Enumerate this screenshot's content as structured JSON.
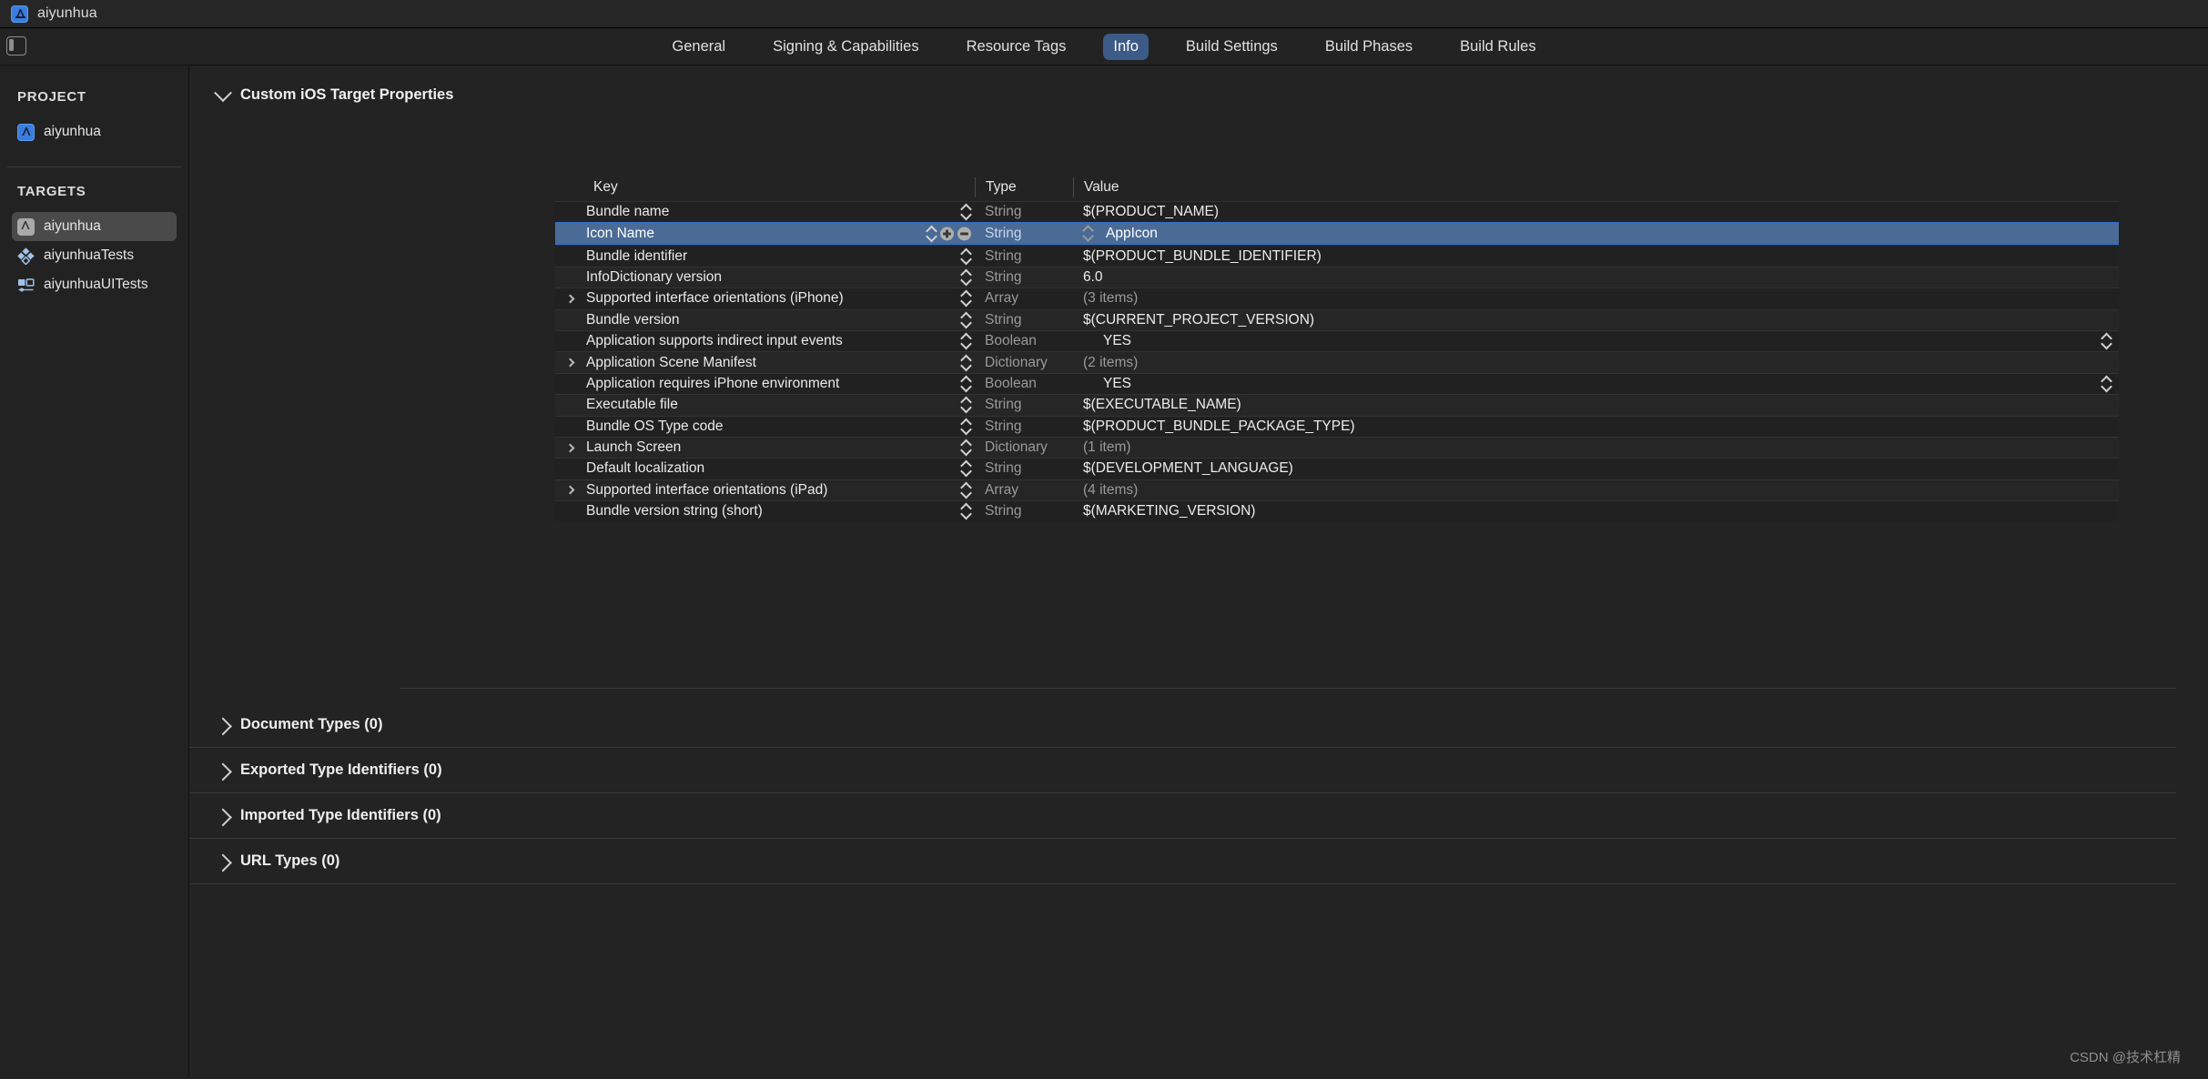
{
  "titlebar": {
    "title": "aiyunhua",
    "icon": "app-store-icon"
  },
  "tabs": [
    {
      "label": "General",
      "active": false
    },
    {
      "label": "Signing & Capabilities",
      "active": false
    },
    {
      "label": "Resource Tags",
      "active": false
    },
    {
      "label": "Info",
      "active": true
    },
    {
      "label": "Build Settings",
      "active": false
    },
    {
      "label": "Build Phases",
      "active": false
    },
    {
      "label": "Build Rules",
      "active": false
    }
  ],
  "sidebar": {
    "project_header": "PROJECT",
    "project_items": [
      {
        "label": "aiyunhua",
        "icon": "app-blue-icon"
      }
    ],
    "targets_header": "TARGETS",
    "target_items": [
      {
        "label": "aiyunhua",
        "icon": "app-gray-icon",
        "selected": true
      },
      {
        "label": "aiyunhuaTests",
        "icon": "unit-test-diamond-icon",
        "selected": false
      },
      {
        "label": "aiyunhuaUITests",
        "icon": "ui-test-icon",
        "selected": false
      }
    ]
  },
  "main": {
    "section_title": "Custom iOS Target Properties",
    "columns": {
      "key": "Key",
      "type": "Type",
      "value": "Value"
    },
    "rows": [
      {
        "key": "Bundle name",
        "type": "String",
        "value": "$(PRODUCT_NAME)",
        "expandable": false,
        "selected": false,
        "value_dim": false
      },
      {
        "key": "Icon Name",
        "type": "String",
        "value": "AppIcon",
        "expandable": false,
        "selected": true,
        "value_dim": false
      },
      {
        "key": "Bundle identifier",
        "type": "String",
        "value": "$(PRODUCT_BUNDLE_IDENTIFIER)",
        "expandable": false,
        "selected": false,
        "value_dim": false
      },
      {
        "key": "InfoDictionary version",
        "type": "String",
        "value": "6.0",
        "expandable": false,
        "selected": false,
        "value_dim": false
      },
      {
        "key": "Supported interface orientations (iPhone)",
        "type": "Array",
        "value": "(3 items)",
        "expandable": true,
        "selected": false,
        "value_dim": true
      },
      {
        "key": "Bundle version",
        "type": "String",
        "value": "$(CURRENT_PROJECT_VERSION)",
        "expandable": false,
        "selected": false,
        "value_dim": false
      },
      {
        "key": "Application supports indirect input events",
        "type": "Boolean",
        "value": "YES",
        "expandable": false,
        "selected": false,
        "value_dim": false,
        "bool_row": true
      },
      {
        "key": "Application Scene Manifest",
        "type": "Dictionary",
        "value": "(2 items)",
        "expandable": true,
        "selected": false,
        "value_dim": true
      },
      {
        "key": "Application requires iPhone environment",
        "type": "Boolean",
        "value": "YES",
        "expandable": false,
        "selected": false,
        "value_dim": false,
        "bool_row": true
      },
      {
        "key": "Executable file",
        "type": "String",
        "value": "$(EXECUTABLE_NAME)",
        "expandable": false,
        "selected": false,
        "value_dim": false
      },
      {
        "key": "Bundle OS Type code",
        "type": "String",
        "value": "$(PRODUCT_BUNDLE_PACKAGE_TYPE)",
        "expandable": false,
        "selected": false,
        "value_dim": false
      },
      {
        "key": "Launch Screen",
        "type": "Dictionary",
        "value": "(1 item)",
        "expandable": true,
        "selected": false,
        "value_dim": true
      },
      {
        "key": "Default localization",
        "type": "String",
        "value": "$(DEVELOPMENT_LANGUAGE)",
        "expandable": false,
        "selected": false,
        "value_dim": false
      },
      {
        "key": "Supported interface orientations (iPad)",
        "type": "Array",
        "value": "(4 items)",
        "expandable": true,
        "selected": false,
        "value_dim": true
      },
      {
        "key": "Bundle version string (short)",
        "type": "String",
        "value": "$(MARKETING_VERSION)",
        "expandable": false,
        "selected": false,
        "value_dim": false
      }
    ],
    "collapsed_sections": [
      {
        "label": "Document Types (0)"
      },
      {
        "label": "Exported Type Identifiers (0)"
      },
      {
        "label": "Imported Type Identifiers (0)"
      },
      {
        "label": "URL Types (0)"
      }
    ]
  },
  "watermark": "CSDN @技术杠精",
  "colors": {
    "accent_blue": "#3c5b86",
    "selection_blue": "#4a6b96",
    "selection_border": "#2f6fd0",
    "background": "#232323"
  }
}
